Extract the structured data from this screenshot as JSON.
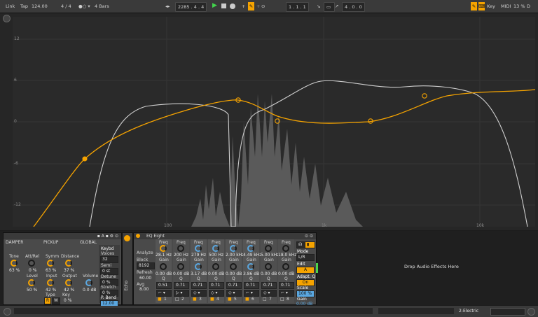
{
  "transport": {
    "link": "Link",
    "tap": "Tap",
    "tempo": "124.00",
    "signature": "4 / 4",
    "metro": "1 Bar",
    "quantize": "4 Bars",
    "position": "2285 . 4 . 4",
    "loop_start": "1 . 1 . 1",
    "loop_length": "4 . 0 . 0",
    "key": "Key",
    "midi": "MIDI",
    "cpu": "13 %",
    "disk": "D"
  },
  "eq_display": {
    "y_labels": [
      "12",
      "6",
      "0",
      "-6",
      "-12"
    ],
    "x_labels": [
      "100",
      "1k",
      "10k"
    ]
  },
  "device1": {
    "sections": [
      "DAMPER",
      "PICKUP",
      "GLOBAL"
    ],
    "tone_label": "Tone",
    "tone_val": "63 %",
    "attrel_label": "Att/Rel",
    "attrel_val": "0 %",
    "level_label": "Level",
    "level_val": "50 %",
    "symm_label": "Symm",
    "symm_val": "63 %",
    "distance_label": "Distance",
    "distance_val": "37 %",
    "input_label": "Input",
    "input_val": "42 %",
    "output_label": "Output",
    "output_val": "42 %",
    "type_label": "Type",
    "type_r": "R",
    "type_w": "W",
    "key_label": "Key",
    "key_val": "0 %",
    "volume_label": "Volume",
    "volume_val": "0.0 dB",
    "keybd_label": "Keybd",
    "voices_label": "Voices",
    "voices_val": "32",
    "semi_label": "Semi",
    "semi_val": "0 st",
    "detune_label": "Detune",
    "detune_val": "0 %",
    "stretch_label": "Stretch",
    "stretch_val": "0 %",
    "pbend_label": "P. Bend",
    "pbend_val": "12.00"
  },
  "echo_label": "Echo",
  "eq8": {
    "title": "EQ Eight",
    "analyze_label": "Analyze",
    "block_label": "Block",
    "block_val": "8192",
    "refresh_label": "Refresh",
    "refresh_val": "60.00",
    "avg_label": "Avg",
    "avg_val": "8.00",
    "bands": [
      {
        "freq": "28.1 Hz",
        "gain": "0.00 dB",
        "q": "0.51",
        "num": "1"
      },
      {
        "freq": "200 Hz",
        "gain": "0.00 dB",
        "q": "0.71",
        "num": "2"
      },
      {
        "freq": "279 Hz",
        "gain": "3.17 dB",
        "q": "0.71",
        "num": "3"
      },
      {
        "freq": "500 Hz",
        "gain": "0.00 dB",
        "q": "0.71",
        "num": "4"
      },
      {
        "freq": "2.00 kHz",
        "gain": "0.00 dB",
        "q": "0.71",
        "num": "5"
      },
      {
        "freq": "4.49 kHz",
        "gain": "3.86 dB",
        "q": "0.71",
        "num": "6"
      },
      {
        "freq": "5.00 kHz",
        "gain": "0.00 dB",
        "q": "0.71",
        "num": "7"
      },
      {
        "freq": "18.0 kHz",
        "gain": "0.00 dB",
        "q": "0.71",
        "num": "8"
      }
    ],
    "freq_label": "Freq",
    "gain_label": "Gain",
    "q_label": "Q",
    "mode_label": "Mode",
    "mode_val": "L/R",
    "edit_label": "Edit",
    "edit_val": "A",
    "adapt_label": "Adapt. Q",
    "adapt_val": "On",
    "scale_label": "Scale",
    "scale_val": "100 %",
    "gain_out_label": "Gain",
    "gain_out_val": "0.00 dB"
  },
  "drop_text": "Drop Audio Effects Here",
  "track_name": "2-Electric"
}
